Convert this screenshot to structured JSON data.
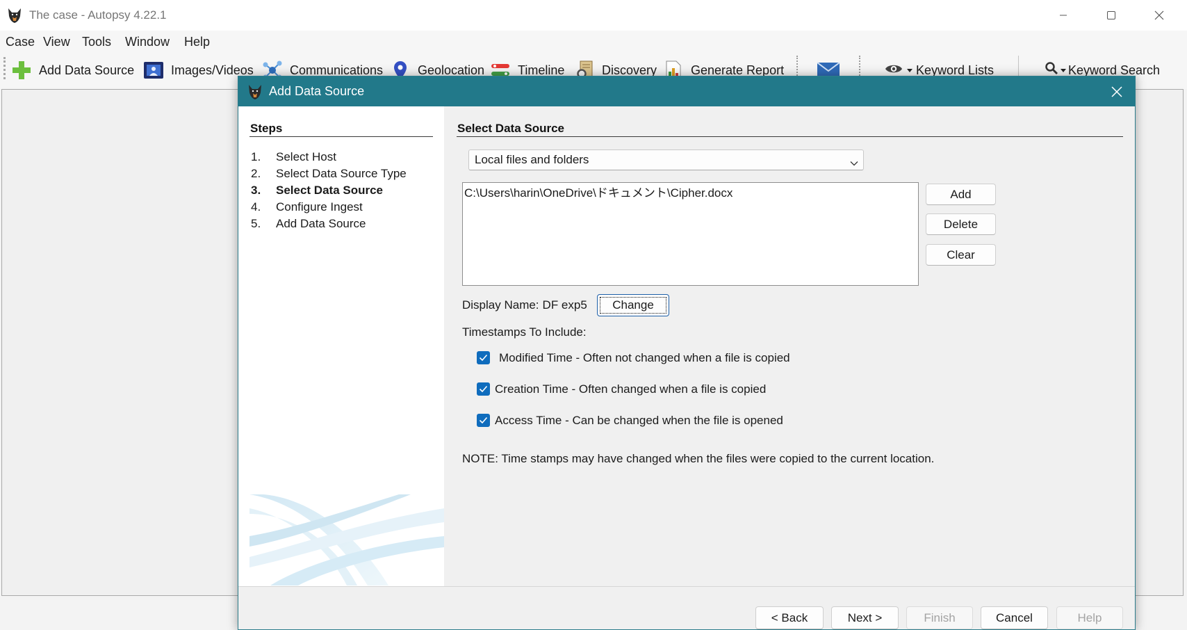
{
  "window": {
    "title": "The case - Autopsy 4.22.1",
    "app_icon": "autopsy-logo-icon"
  },
  "menu": {
    "items": [
      "Case",
      "View",
      "Tools",
      "Window",
      "Help"
    ]
  },
  "toolbar": {
    "items": [
      {
        "label": "Add Data Source",
        "icon": "add-plus-icon"
      },
      {
        "label": "Images/Videos",
        "icon": "images-videos-icon"
      },
      {
        "label": "Communications",
        "icon": "communications-icon"
      },
      {
        "label": "Geolocation",
        "icon": "geolocation-pin-icon"
      },
      {
        "label": "Timeline",
        "icon": "timeline-icon"
      },
      {
        "label": "Discovery",
        "icon": "discovery-icon"
      },
      {
        "label": "Generate Report",
        "icon": "report-chart-icon"
      }
    ],
    "email_icon": "email-icon",
    "keyword_lists": {
      "label": "Keyword Lists",
      "icon": "eye-icon"
    },
    "keyword_search": {
      "label": "Keyword Search",
      "icon": "search-icon"
    }
  },
  "dialog": {
    "title": "Add Data Source",
    "accent_color": "#22798a",
    "steps": {
      "heading": "Steps",
      "items": [
        {
          "number": "1.",
          "label": "Select Host"
        },
        {
          "number": "2.",
          "label": "Select Data Source Type"
        },
        {
          "number": "3.",
          "label": "Select Data Source",
          "current": true
        },
        {
          "number": "4.",
          "label": "Configure Ingest"
        },
        {
          "number": "5.",
          "label": "Add Data Source"
        }
      ]
    },
    "panel": {
      "heading": "Select Data Source",
      "source_type": {
        "selected": "Local files and folders"
      },
      "files": [
        "C:\\Users\\harin\\OneDrive\\ドキュメント\\Cipher.docx"
      ],
      "file_buttons": {
        "add": "Add",
        "delete": "Delete",
        "clear": "Clear"
      },
      "display_name": {
        "label": "Display Name:",
        "value": "DF exp5",
        "change_button": "Change"
      },
      "timestamps": {
        "heading": "Timestamps To Include:",
        "options": [
          {
            "label": "Modified Time - Often not changed when a file is copied",
            "checked": true
          },
          {
            "label": "Creation Time - Often changed when a file is copied",
            "checked": true
          },
          {
            "label": "Access Time - Can be changed when the file is opened",
            "checked": true
          }
        ]
      },
      "note": "NOTE: Time stamps may have changed when the files were copied to the current location."
    },
    "footer": {
      "buttons": [
        {
          "label": "< Back",
          "enabled": true
        },
        {
          "label": "Next >",
          "enabled": true
        },
        {
          "label": "Finish",
          "enabled": false
        },
        {
          "label": "Cancel",
          "enabled": true
        },
        {
          "label": "Help",
          "enabled": false
        }
      ]
    }
  }
}
